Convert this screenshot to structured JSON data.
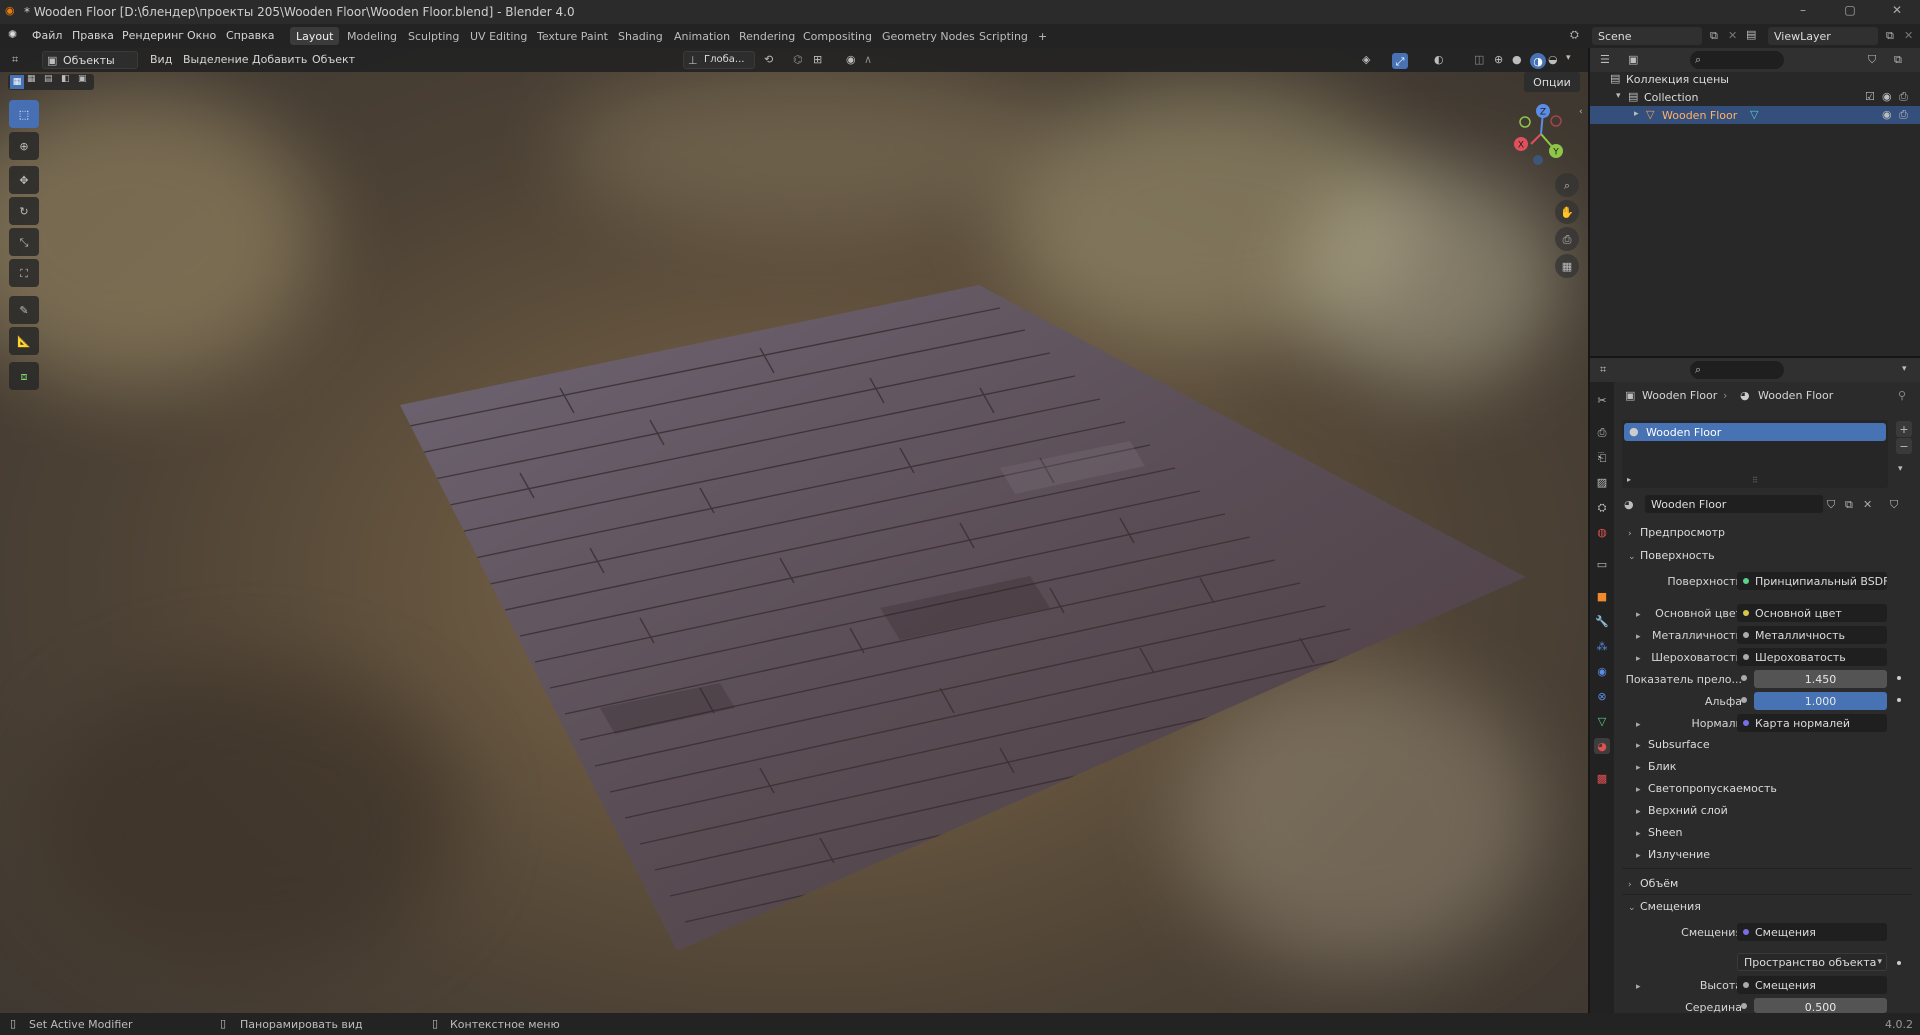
{
  "window": {
    "title": "* Wooden Floor [D:\\блендер\\проекты 205\\Wooden Floor\\Wooden Floor.blend] - Blender 4.0",
    "minimize": "–",
    "maximize": "▢",
    "close": "✕"
  },
  "menu": [
    "Файл",
    "Правка",
    "Рендеринг",
    "Окно",
    "Справка"
  ],
  "workspaces": [
    "Layout",
    "Modeling",
    "Sculpting",
    "UV Editing",
    "Texture Paint",
    "Shading",
    "Animation",
    "Rendering",
    "Compositing",
    "Geometry Nodes",
    "Scripting"
  ],
  "workspace_add": "+",
  "scene": {
    "label": "Scene",
    "view_layer": "ViewLayer"
  },
  "viewport_header": {
    "mode": "Объекты",
    "menus": [
      "Вид",
      "Выделение",
      "Добавить",
      "Объект"
    ],
    "transform_orientation": "Глоба...",
    "options": "Опции"
  },
  "gizmo": {
    "x": "X",
    "y": "Y",
    "z": "Z"
  },
  "outliner": {
    "scene_collection": "Коллекция сцены",
    "collection": "Collection",
    "object": "Wooden Floor"
  },
  "properties": {
    "breadcrumb_object": "Wooden Floor",
    "breadcrumb_material": "Wooden Floor",
    "slot": "Wooden Floor",
    "material_name": "Wooden Floor",
    "sections": {
      "preview": "Предпросмотр",
      "surface": "Поверхность",
      "volume": "Объём",
      "displacement": "Смещения"
    },
    "surface_label": "Поверхность",
    "surface_value": "Принципиальный BSDF",
    "rows": [
      {
        "label": "Основной цвет",
        "value": "Основной цвет"
      },
      {
        "label": "Металличность",
        "value": "Металличность"
      },
      {
        "label": "Шероховатость",
        "value": "Шероховатость"
      }
    ],
    "ior_label": "Показатель прело...",
    "ior_value": "1.450",
    "alpha_label": "Альфа",
    "alpha_value": "1.000",
    "normal_label": "Нормаль",
    "normal_value": "Карта нормалей",
    "subpanels": [
      "Subsurface",
      "Блик",
      "Светопропускаемость",
      "Верхний слой",
      "Sheen",
      "Излучение"
    ],
    "disp_label": "Смещения",
    "disp_value": "Смещения",
    "space_value": "Пространство объекта",
    "height_label": "Высота",
    "height_value": "Смещения",
    "mid_label": "Середина",
    "mid_value": "0.500"
  },
  "status": {
    "left": "Set Active Modifier",
    "middle": "Панорамировать вид",
    "right": "Контекстное меню",
    "version": "4.0.2"
  },
  "colors": {
    "accent": "#4772b3",
    "selection": "#344f7c",
    "panel": "#2b2b2b"
  }
}
